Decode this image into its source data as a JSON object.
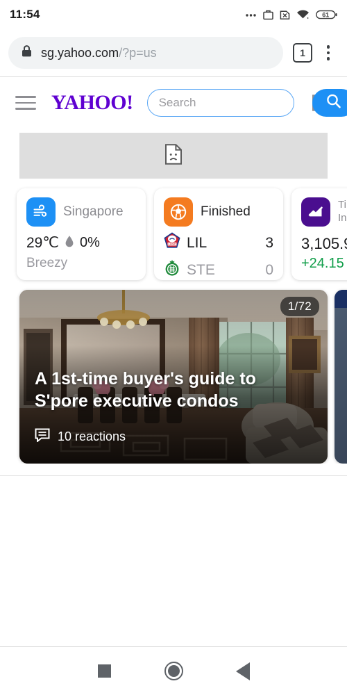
{
  "status_bar": {
    "time": "11:54",
    "battery_level": "61",
    "icons": [
      "overflow-dots-icon",
      "work-profile-icon",
      "sim-missing-icon",
      "wifi-icon",
      "battery-icon"
    ]
  },
  "browser": {
    "url_domain": "sg.yahoo.com",
    "url_path": "/?p=us",
    "lock_icon": "lock-icon",
    "tab_count": "1",
    "menu_icon": "kebab-menu-icon"
  },
  "site_header": {
    "menu_icon": "hamburger-icon",
    "logo_text": "YAHOO!",
    "logo_color": "#5f01d1",
    "search_placeholder": "Search",
    "search_value": "",
    "search_button_icon": "search-icon",
    "search_button_color": "#1d90f5",
    "mail_icon": "mail-icon"
  },
  "broken_banner": {
    "icon": "broken-image-icon"
  },
  "cards": {
    "weather": {
      "badge_icon": "wind-icon",
      "badge_color": "#1d90f5",
      "location": "Singapore",
      "temperature": "29℃",
      "humidity_icon": "water-drop-icon",
      "humidity": "0%",
      "condition": "Breezy"
    },
    "sports": {
      "badge_icon": "soccer-ball-icon",
      "badge_color": "#f47b20",
      "status": "Finished",
      "teams": [
        {
          "abbr": "LIL",
          "score": "3",
          "logo": "lille-crest-icon"
        },
        {
          "abbr": "STE",
          "score": "0",
          "logo": "saint-etienne-crest-icon"
        }
      ]
    },
    "finance": {
      "badge_icon": "line-chart-icon",
      "badge_color": "#4a0e8f",
      "index_name_line1": "Ti",
      "index_name_line2": "In",
      "price": "3,105.9",
      "change": "+24.15 (",
      "change_color": "#119e4a"
    }
  },
  "hero": {
    "counter": "1/72",
    "title": "A 1st-time buyer's guide to S'pore executive condos",
    "reactions_icon": "comment-icon",
    "reactions": "10 reactions"
  },
  "nav_bar": {
    "recents_icon": "square-recents-icon",
    "home_icon": "circle-home-icon",
    "back_icon": "triangle-back-icon"
  }
}
